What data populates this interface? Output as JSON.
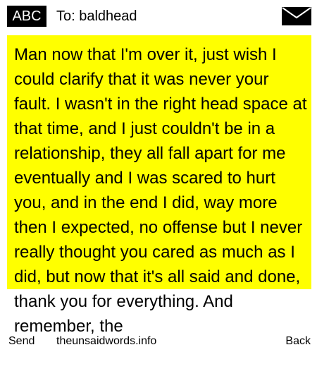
{
  "header": {
    "badge_label": "ABC",
    "to_label": "To: baldhead",
    "icon": "envelope-icon"
  },
  "message": {
    "text": "Man now that I'm over it, just wish I could clarify that it was never your fault. I wasn't in the right head space at that time, and I just couldn't be in a relationship, they all fall apart for me eventually and I was scared to hurt you, and in the end I did, way more then I expected, no offense but I never really thought you cared as much as I did, but now that it's all said and done, thank you for everything. And remember, the"
  },
  "softkeys": {
    "left_label": "Send",
    "center_label": "theunsaidwords.info",
    "right_label": "Back"
  },
  "colors": {
    "highlight": "#ffff00",
    "badge_background": "#000000",
    "page_background": "#ffffff"
  }
}
